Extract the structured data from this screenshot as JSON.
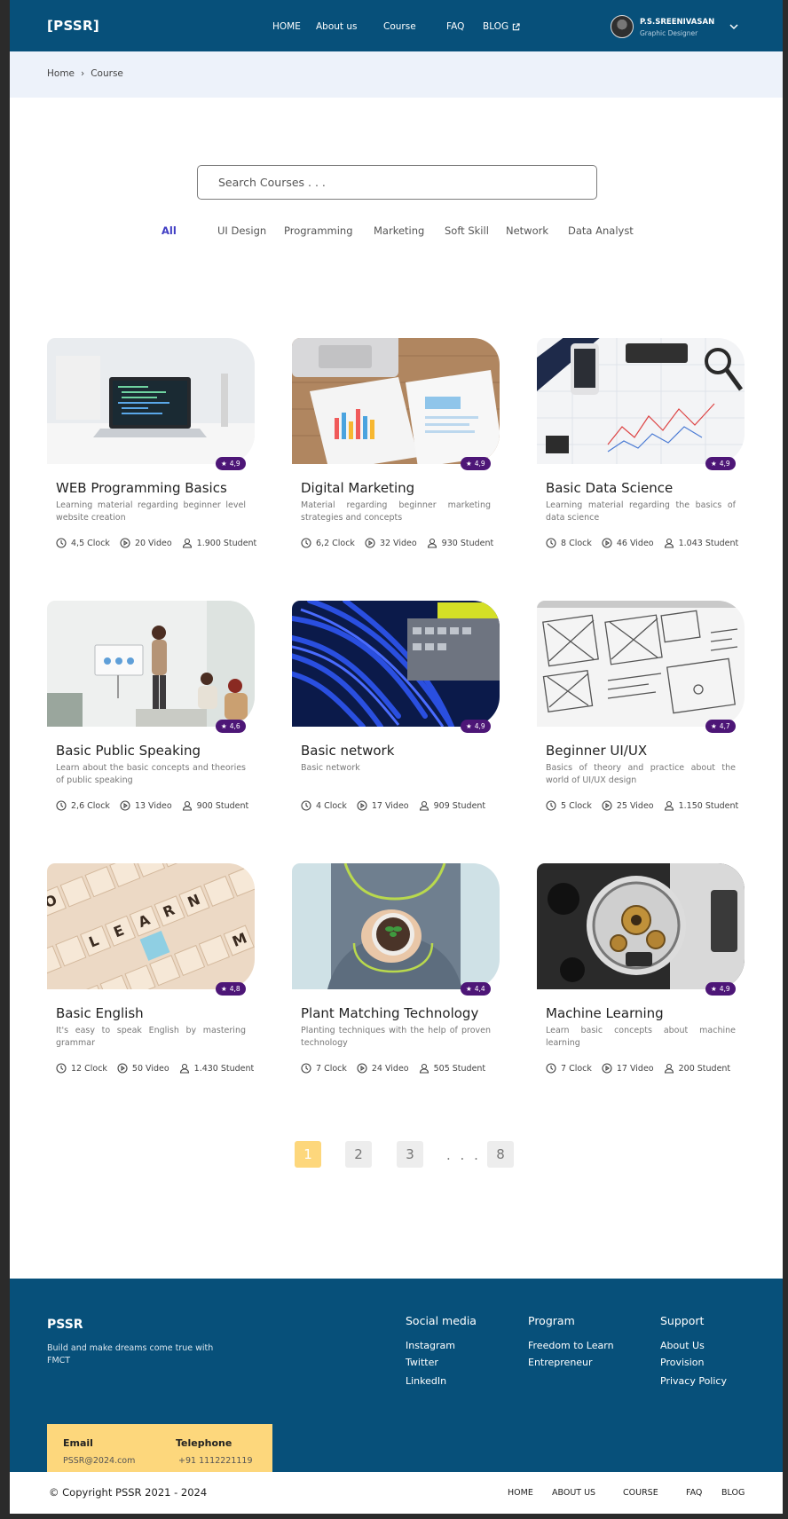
{
  "header": {
    "logo": "[PSSR]",
    "nav": [
      "HOME",
      "About us",
      "Course",
      "FAQ",
      "BLOG"
    ],
    "user": {
      "name": "P.S.SREENIVASAN",
      "role": "Graphic Designer"
    }
  },
  "breadcrumb": {
    "home": "Home",
    "separator": "›",
    "current": "Course"
  },
  "search": {
    "placeholder": "Search Courses . . ."
  },
  "filters": [
    "All",
    "UI Design",
    "Programming",
    "Marketing",
    "Soft Skill",
    "Network",
    "Data Analyst"
  ],
  "courses": [
    {
      "title": "WEB Programming Basics",
      "desc": "Learning material regarding beginner level website creation",
      "rating": "4,9",
      "clock": "4,5 Clock",
      "video": "20 Video",
      "students": "1.900 Student"
    },
    {
      "title": "Digital Marketing",
      "desc": "Material regarding beginner marketing strategies and concepts",
      "rating": "4,9",
      "clock": "6,2 Clock",
      "video": "32 Video",
      "students": "930 Student"
    },
    {
      "title": "Basic Data Science",
      "desc": "Learning material regarding the basics of data science",
      "rating": "4,9",
      "clock": "8 Clock",
      "video": "46 Video",
      "students": "1.043 Student"
    },
    {
      "title": "Basic Public Speaking",
      "desc": "Learn about the basic concepts and theories of public speaking",
      "rating": "4,6",
      "clock": "2,6 Clock",
      "video": "13 Video",
      "students": "900 Student"
    },
    {
      "title": "Basic network",
      "desc": "Basic network",
      "rating": "4,9",
      "clock": "4 Clock",
      "video": "17 Video",
      "students": "909 Student"
    },
    {
      "title": "Beginner UI/UX",
      "desc": "Basics of theory and practice about the world of UI/UX design",
      "rating": "4,7",
      "clock": "5 Clock",
      "video": "25 Video",
      "students": "1.150 Student"
    },
    {
      "title": "Basic English",
      "desc": "It's easy to speak English by mastering grammar",
      "rating": "4,8",
      "clock": "12 Clock",
      "video": "50 Video",
      "students": "1.430 Student"
    },
    {
      "title": "Plant Matching Technology",
      "desc": "Planting techniques with the help of proven technology",
      "rating": "4,4",
      "clock": "7 Clock",
      "video": "24 Video",
      "students": "505 Student"
    },
    {
      "title": "Machine Learning",
      "desc": "Learn basic concepts about machine learning",
      "rating": "4,9",
      "clock": "7 Clock",
      "video": "17 Video",
      "students": "200 Student"
    }
  ],
  "pagination": {
    "pages": [
      "1",
      "2",
      "3",
      "8"
    ],
    "ellipsis": ". . .",
    "active": "1"
  },
  "footer": {
    "brand": "PSSR",
    "tagline": "Build and make dreams come true with FMCT",
    "columns": [
      {
        "title": "Social media",
        "links": [
          "Instagram",
          "Twitter",
          "LinkedIn"
        ]
      },
      {
        "title": "Program",
        "links": [
          "Freedom to Learn",
          "Entrepreneur"
        ]
      },
      {
        "title": "Support",
        "links": [
          "About Us",
          "Provision",
          "Privacy Policy"
        ]
      }
    ],
    "contact": {
      "email_label": "Email",
      "email": "PSSR@2024.com",
      "phone_label": "Telephone",
      "phone": "+91 1112221119"
    },
    "copyright": "© Copyright PSSR 2021 - 2024",
    "bottom_nav": [
      "HOME",
      "ABOUT US",
      "COURSE",
      "FAQ",
      "BLOG"
    ]
  },
  "colors": {
    "primary": "#07507a",
    "accent": "#fdd77c",
    "rating_badge": "#4d1677",
    "active_filter": "#3f3cc3"
  }
}
